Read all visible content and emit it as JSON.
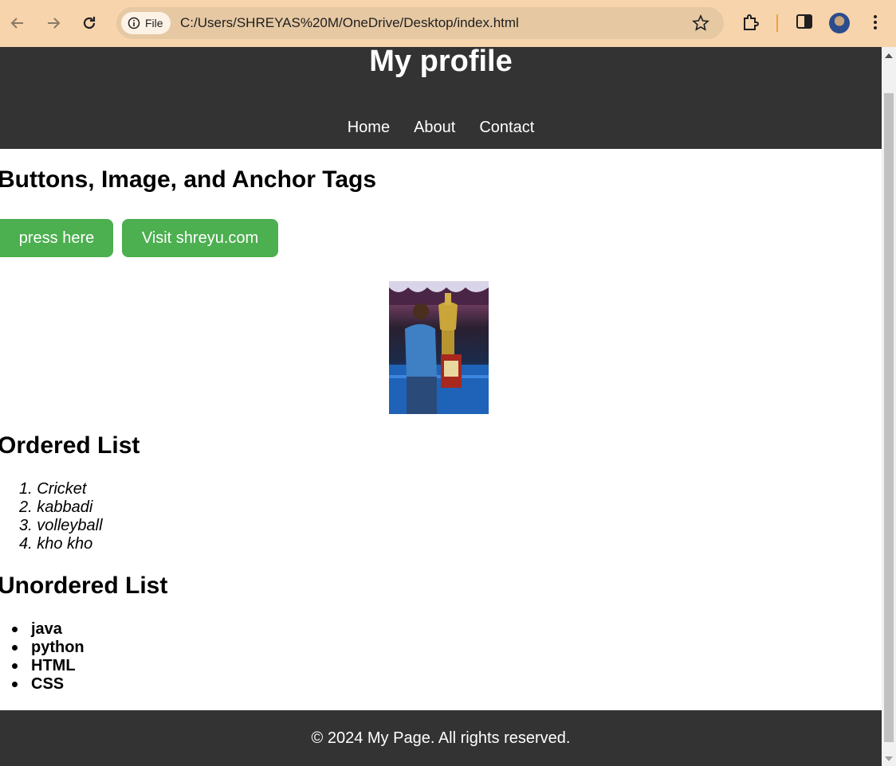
{
  "browser": {
    "site_chip": "File",
    "url": "C:/Users/SHREYAS%20M/OneDrive/Desktop/index.html"
  },
  "page": {
    "title": "My profile",
    "nav": [
      "Home",
      "About",
      "Contact"
    ],
    "section_buttons_heading": "Buttons, Image, and Anchor Tags",
    "button_press": "press here",
    "button_visit": "Visit shreyu.com",
    "ordered_heading": "Ordered List",
    "ordered_items": [
      "Cricket",
      "kabbadi",
      "volleyball",
      "kho kho"
    ],
    "unordered_heading": "Unordered List",
    "unordered_items": [
      "java",
      "python",
      "HTML",
      "CSS"
    ],
    "footer": "© 2024 My Page. All rights reserved."
  },
  "colors": {
    "chrome_bg": "#f7d4ac",
    "header_bg": "#333333",
    "button_bg": "#4caf50"
  }
}
